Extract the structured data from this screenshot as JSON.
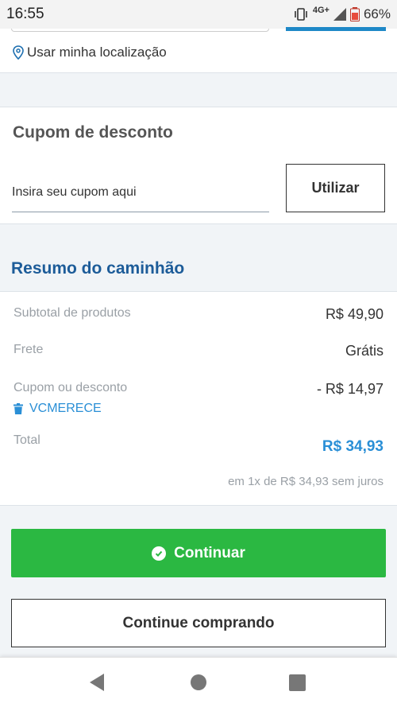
{
  "status_bar": {
    "time": "16:55",
    "network": "4G+",
    "battery": "66%"
  },
  "location": {
    "label": "Usar minha localização"
  },
  "coupon": {
    "title": "Cupom de desconto",
    "input_placeholder": "Insira seu cupom aqui",
    "input_value": "",
    "apply_label": "Utilizar"
  },
  "summary": {
    "title": "Resumo do caminhão",
    "subtotal_label": "Subtotal de produtos",
    "subtotal_value": "R$ 49,90",
    "shipping_label": "Frete",
    "shipping_value": "Grátis",
    "discount_label": "Cupom ou desconto",
    "discount_value": "- R$ 14,97",
    "coupon_code": "VCMERECE",
    "total_label": "Total",
    "total_value": "R$ 34,93",
    "installments": "em 1x de R$ 34,93 sem juros"
  },
  "actions": {
    "continue_label": "Continuar",
    "keep_shopping_label": "Continue comprando"
  },
  "colors": {
    "primary_blue": "#1d5c99",
    "link_blue": "#2a8fd6",
    "success_green": "#2bb842"
  },
  "icons": {
    "location": "map-pin-icon",
    "trash": "trash-icon",
    "check": "check-circle-icon"
  }
}
